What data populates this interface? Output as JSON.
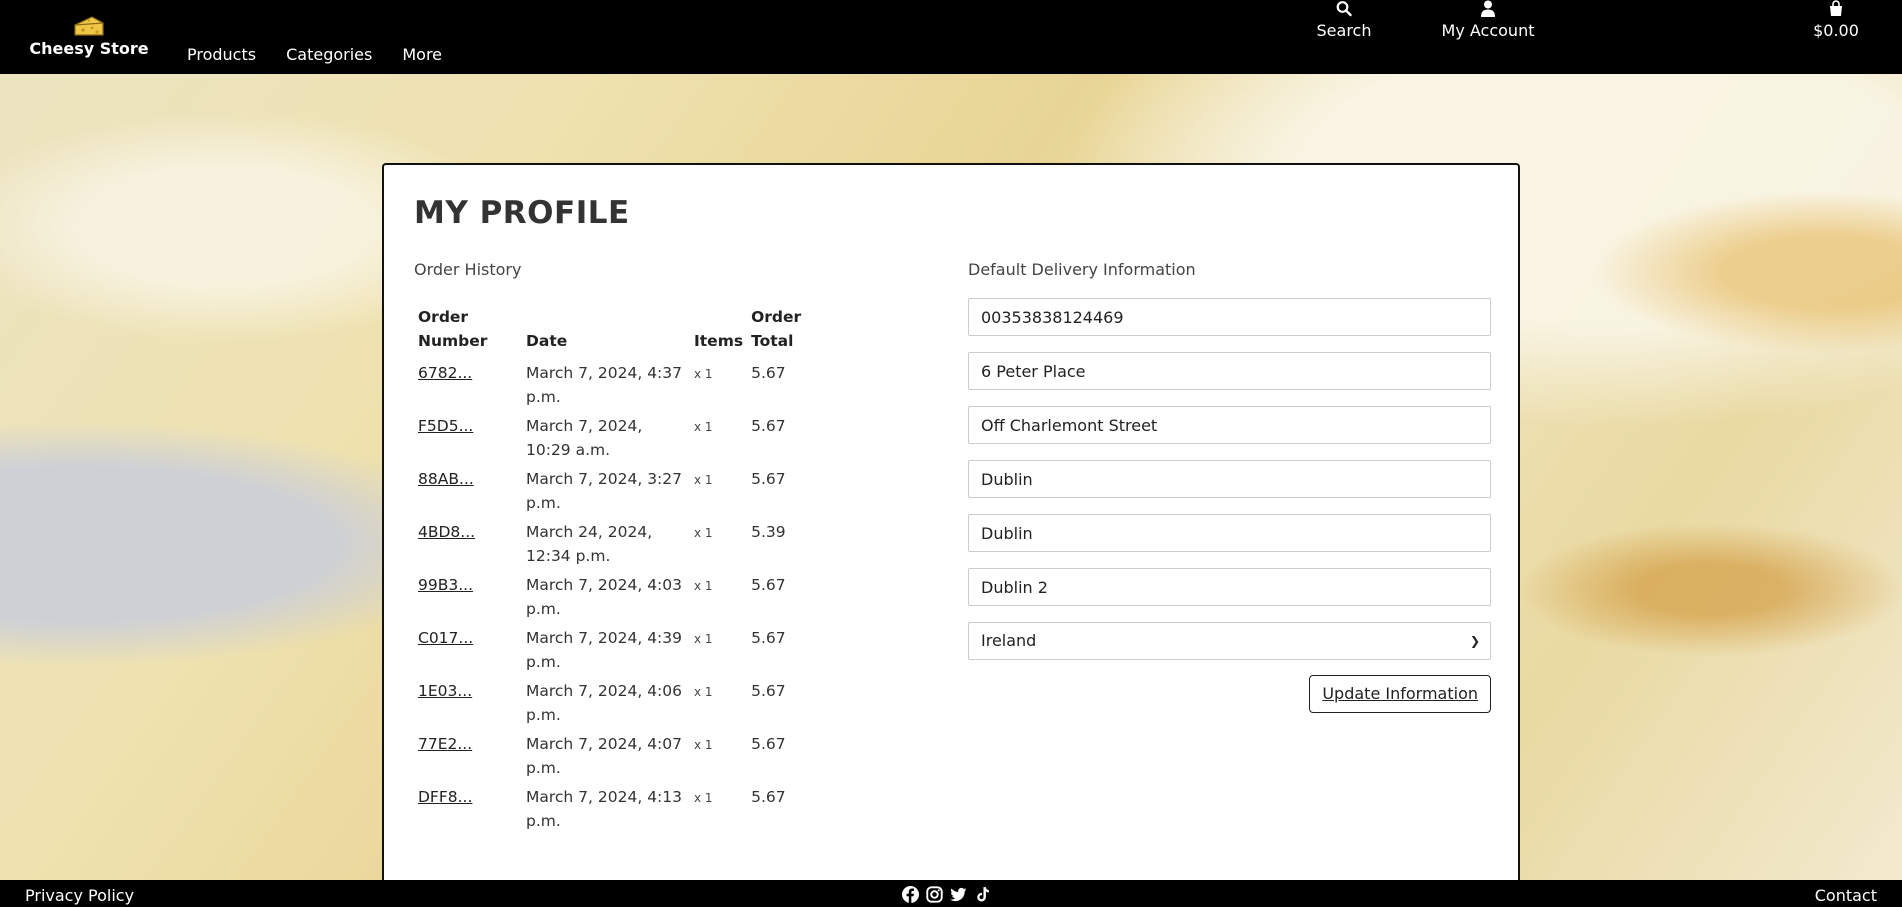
{
  "header": {
    "brand": "Cheesy Store",
    "nav": [
      "Products",
      "Categories",
      "More"
    ],
    "search_label": "Search",
    "account_label": "My Account",
    "bag_total": "$0.00"
  },
  "profile": {
    "title": "MY PROFILE",
    "order_history_label": "Order History",
    "columns": {
      "number": "Order Number",
      "date": "Date",
      "items": "Items",
      "total": "Order Total"
    },
    "orders": [
      {
        "number": "6782...",
        "date": "March 7, 2024, 4:37 p.m.",
        "qty": "x 1",
        "total": "5.67"
      },
      {
        "number": "F5D5...",
        "date": "March 7, 2024, 10:29 a.m.",
        "qty": "x 1",
        "total": "5.67"
      },
      {
        "number": "88AB...",
        "date": "March 7, 2024, 3:27 p.m.",
        "qty": "x 1",
        "total": "5.67"
      },
      {
        "number": "4BD8...",
        "date": "March 24, 2024, 12:34 p.m.",
        "qty": "x 1",
        "total": "5.39"
      },
      {
        "number": "99B3...",
        "date": "March 7, 2024, 4:03 p.m.",
        "qty": "x 1",
        "total": "5.67"
      },
      {
        "number": "C017...",
        "date": "March 7, 2024, 4:39 p.m.",
        "qty": "x 1",
        "total": "5.67"
      },
      {
        "number": "1E03...",
        "date": "March 7, 2024, 4:06 p.m.",
        "qty": "x 1",
        "total": "5.67"
      },
      {
        "number": "77E2...",
        "date": "March 7, 2024, 4:07 p.m.",
        "qty": "x 1",
        "total": "5.67"
      },
      {
        "number": "DFF8...",
        "date": "March 7, 2024, 4:13 p.m.",
        "qty": "x 1",
        "total": "5.67"
      }
    ],
    "delivery_label": "Default Delivery Information",
    "delivery": {
      "phone": "00353838124469",
      "street1": "6 Peter Place",
      "street2": "Off Charlemont Street",
      "town": "Dublin",
      "county": "Dublin",
      "postcode": "Dublin 2",
      "country": "Ireland"
    },
    "update_label": "Update Information"
  },
  "footer": {
    "privacy": "Privacy Policy",
    "contact": "Contact",
    "socials": [
      "facebook-icon",
      "instagram-icon",
      "twitter-icon",
      "tiktok-icon"
    ]
  }
}
